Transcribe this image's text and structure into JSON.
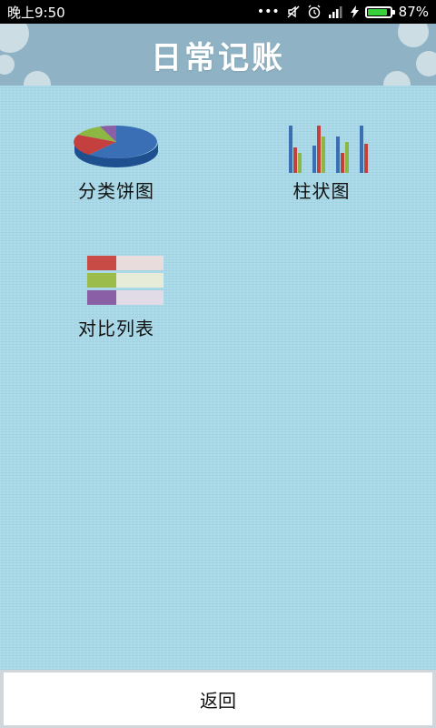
{
  "status_bar": {
    "time": "晚上9:50",
    "battery": "87%",
    "battery_level": 0.87,
    "icons": [
      "more-dots-icon",
      "mute-icon",
      "alarm-icon",
      "signal-icon",
      "charging-icon",
      "battery-icon"
    ]
  },
  "header": {
    "title": "日常记账"
  },
  "menu": {
    "items": [
      {
        "label": "分类饼图",
        "icon": "pie-chart-icon"
      },
      {
        "label": "柱状图",
        "icon": "bar-chart-icon"
      },
      {
        "label": "对比列表",
        "icon": "list-compare-icon"
      }
    ]
  },
  "footer": {
    "back_label": "返回"
  },
  "colors": {
    "background": "#a8d9e9",
    "header": "#8fb3c4",
    "status_bar": "#000000",
    "battery_fill": "#36d13a",
    "bar_blue": "#3a6fb5",
    "bar_red": "#c4403e",
    "bar_green": "#8cb743",
    "list_red": "#c94b45",
    "list_green": "#9bbb4a",
    "list_purple": "#8a5fa6"
  }
}
